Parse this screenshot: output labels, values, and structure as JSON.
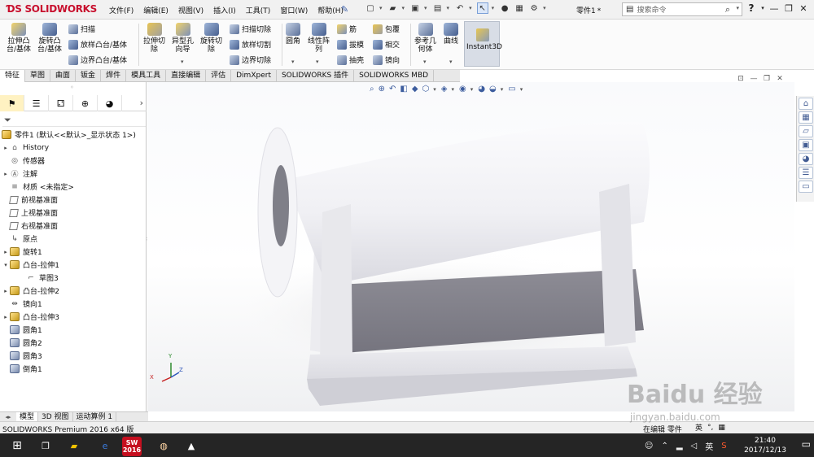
{
  "app": {
    "logo": "SOLIDWORKS",
    "document_title": "零件1",
    "modified_mark": "*"
  },
  "menu": [
    "文件(F)",
    "编辑(E)",
    "视图(V)",
    "插入(I)",
    "工具(T)",
    "窗口(W)",
    "帮助(H)"
  ],
  "search": {
    "placeholder": "搜索命令"
  },
  "ribbon": {
    "extrude_boss": "拉伸凸\n台/基体",
    "revolve_boss": "旋转凸\n台/基体",
    "sweep": "扫描",
    "loft_boss": "放样凸台/基体",
    "boundary_boss": "边界凸台/基体",
    "extrude_cut": "拉伸切\n除",
    "hole_wizard": "异型孔\n向导",
    "revolve_cut": "旋转切\n除",
    "sweep_cut": "扫描切除",
    "loft_cut": "放样切割",
    "boundary_cut": "边界切除",
    "fillet": "圆角",
    "linear_pattern": "线性阵\n列",
    "rib": "筋",
    "draft": "拔模",
    "shell": "抽壳",
    "wrap": "包覆",
    "intersect": "相交",
    "mirror": "镜向",
    "reference_geometry": "参考几\n何体",
    "curves": "曲线",
    "instant3d": "Instant3D"
  },
  "tabs": [
    "特征",
    "草图",
    "曲面",
    "钣金",
    "焊件",
    "模具工具",
    "直接编辑",
    "评估",
    "DimXpert",
    "SOLIDWORKS 插件",
    "SOLIDWORKS MBD"
  ],
  "tree": {
    "root": "零件1 (默认<<默认>_显示状态 1>)",
    "items": [
      "History",
      "传感器",
      "注解",
      "材质 <未指定>",
      "前视基准面",
      "上视基准面",
      "右视基准面",
      "原点",
      "旋转1",
      "凸台-拉伸1",
      "草图3",
      "凸台-拉伸2",
      "镜向1",
      "凸台-拉伸3",
      "圆角1",
      "圆角2",
      "圆角3",
      "倒角1"
    ]
  },
  "bottom_tabs": [
    "模型",
    "3D 视图",
    "运动算例 1"
  ],
  "status": {
    "left": "SOLIDWORKS Premium 2016 x64 版",
    "right": "在编辑 零件",
    "ime_lang": "英"
  },
  "taskbar": {
    "time": "21:40",
    "date": "2017/12/13",
    "lang": "英",
    "sw_label": "SW 2016"
  },
  "triad": {
    "x": "X",
    "y": "Y",
    "z": "Z"
  },
  "watermark": {
    "main": "Baidu 经验",
    "sub": "jingyan.baidu.com"
  },
  "colors": {
    "brand": "#C8102E",
    "ribbon_bg": "#FBFBFB",
    "tab_active": "#FFFFFF",
    "taskbar": "#252525"
  }
}
